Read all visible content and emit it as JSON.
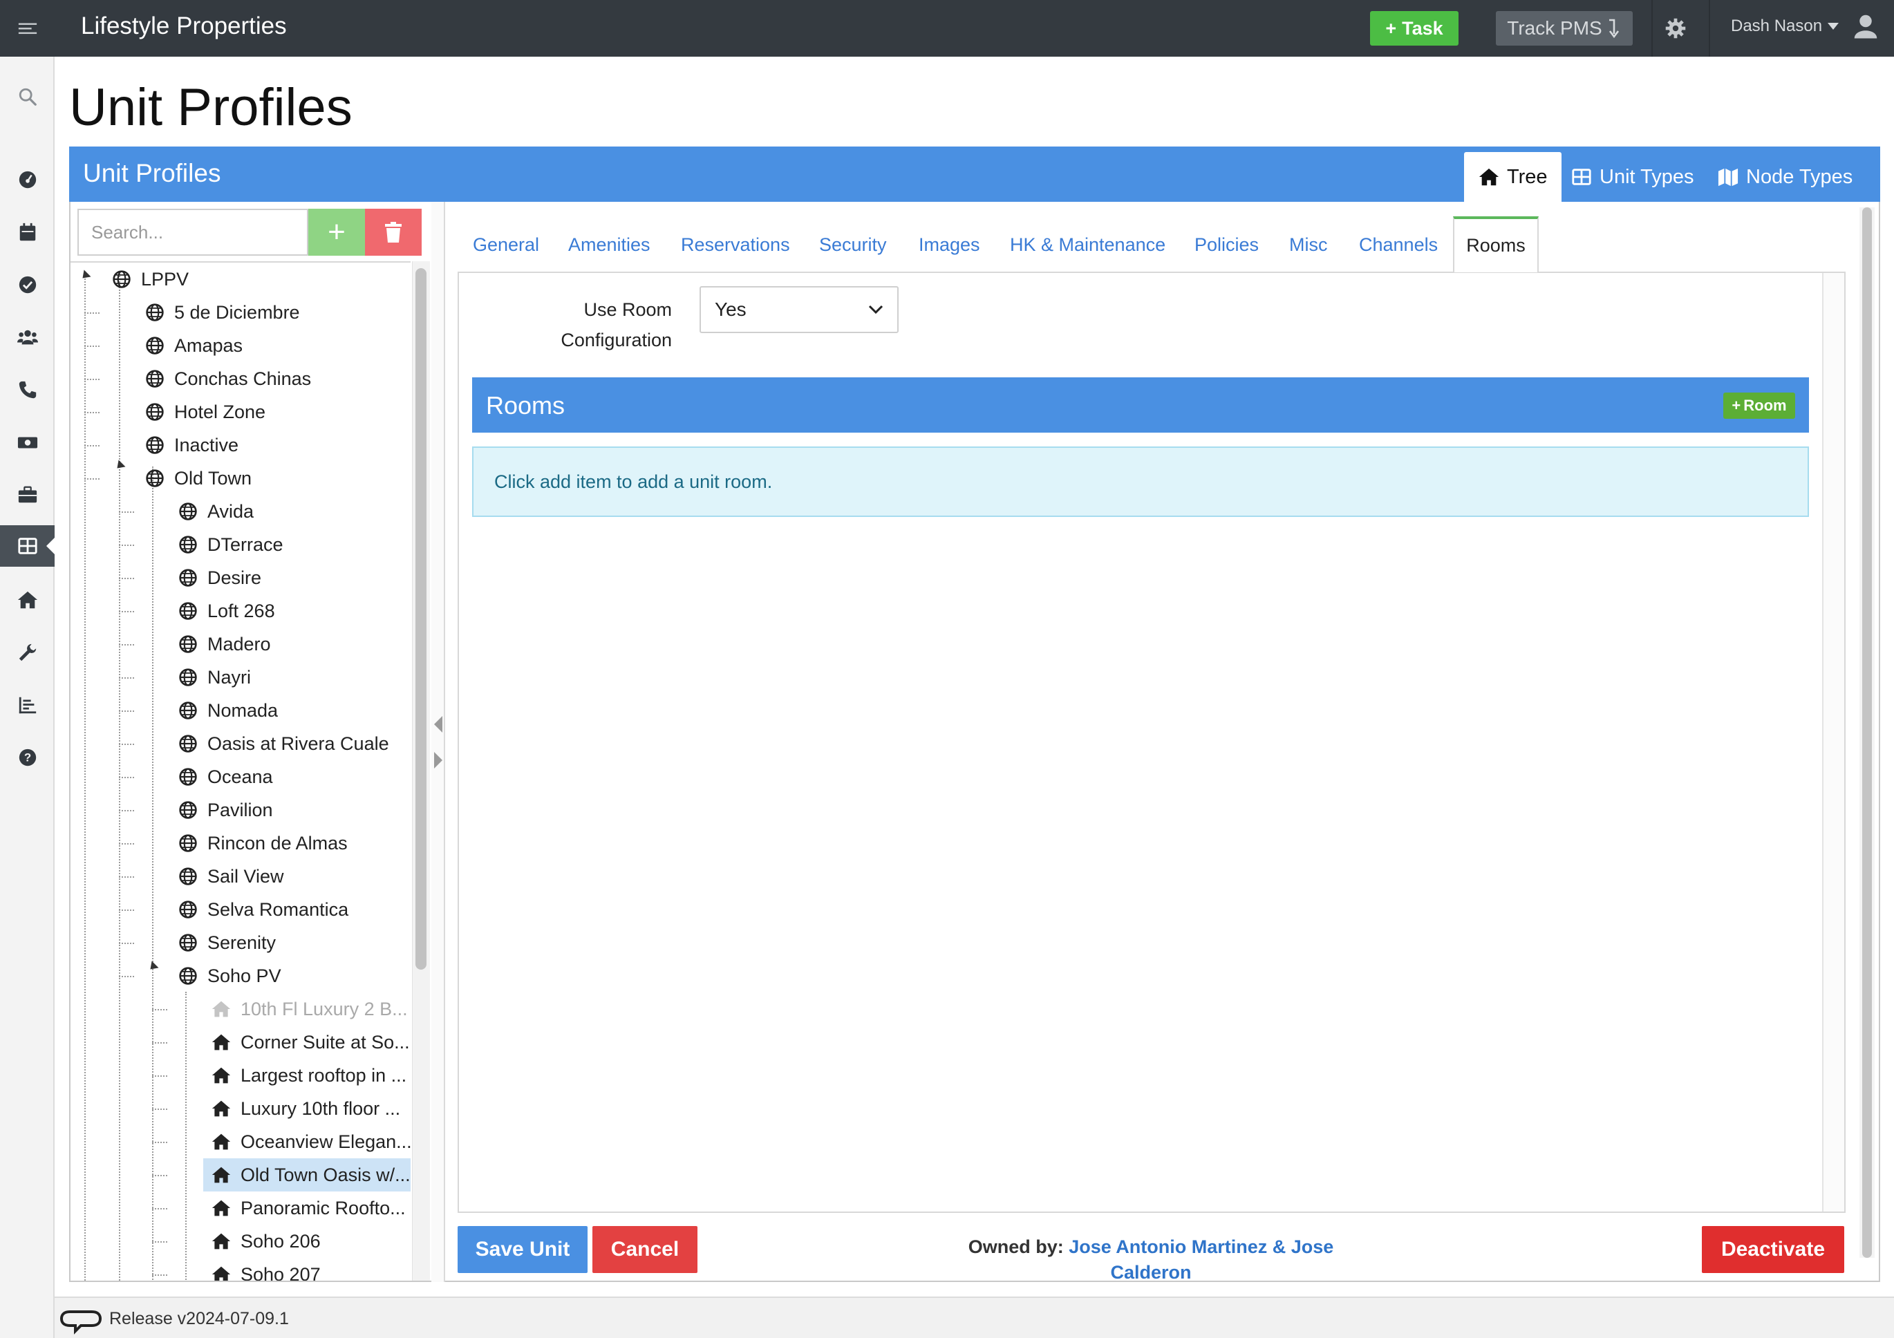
{
  "app": {
    "brand": "Lifestyle Properties",
    "task_button": "Task",
    "track_button": "Track PMS",
    "user_name": "Dash Nason"
  },
  "page": {
    "title": "Unit Profiles"
  },
  "panel": {
    "title": "Unit Profiles",
    "tabs": [
      {
        "label": "Tree",
        "icon": "home-icon",
        "active": true
      },
      {
        "label": "Unit Types",
        "icon": "grid-icon",
        "active": false
      },
      {
        "label": "Node Types",
        "icon": "map-icon",
        "active": false
      }
    ]
  },
  "tree": {
    "search_placeholder": "Search...",
    "nodes": [
      {
        "label": "LPPV",
        "icon": "globe-icon",
        "level": 0
      },
      {
        "label": "5 de Diciembre",
        "icon": "globe-icon",
        "level": 1
      },
      {
        "label": "Amapas",
        "icon": "globe-icon",
        "level": 1
      },
      {
        "label": "Conchas Chinas",
        "icon": "globe-icon",
        "level": 1
      },
      {
        "label": "Hotel Zone",
        "icon": "globe-icon",
        "level": 1
      },
      {
        "label": "Inactive",
        "icon": "globe-icon",
        "level": 1
      },
      {
        "label": "Old Town",
        "icon": "globe-icon",
        "level": 1
      },
      {
        "label": "Avida",
        "icon": "globe-icon",
        "level": 2
      },
      {
        "label": "DTerrace",
        "icon": "globe-icon",
        "level": 2
      },
      {
        "label": "Desire",
        "icon": "globe-icon",
        "level": 2
      },
      {
        "label": "Loft 268",
        "icon": "globe-icon",
        "level": 2
      },
      {
        "label": "Madero",
        "icon": "globe-icon",
        "level": 2
      },
      {
        "label": "Nayri",
        "icon": "globe-icon",
        "level": 2
      },
      {
        "label": "Nomada",
        "icon": "globe-icon",
        "level": 2
      },
      {
        "label": "Oasis at Rivera Cuale",
        "icon": "globe-icon",
        "level": 2
      },
      {
        "label": "Oceana",
        "icon": "globe-icon",
        "level": 2
      },
      {
        "label": "Pavilion",
        "icon": "globe-icon",
        "level": 2
      },
      {
        "label": "Rincon de Almas",
        "icon": "globe-icon",
        "level": 2
      },
      {
        "label": "Sail View",
        "icon": "globe-icon",
        "level": 2
      },
      {
        "label": "Selva Romantica",
        "icon": "globe-icon",
        "level": 2
      },
      {
        "label": "Serenity",
        "icon": "globe-icon",
        "level": 2
      },
      {
        "label": "Soho PV",
        "icon": "globe-icon",
        "level": 2
      },
      {
        "label": "10th Fl Luxury 2 B...",
        "icon": "home-icon",
        "level": 3,
        "state": "inactive"
      },
      {
        "label": "Corner Suite at So...",
        "icon": "home-icon",
        "level": 3
      },
      {
        "label": "Largest rooftop in ...",
        "icon": "home-icon",
        "level": 3
      },
      {
        "label": "Luxury 10th floor ...",
        "icon": "home-icon",
        "level": 3
      },
      {
        "label": "Oceanview Elegan...",
        "icon": "home-icon",
        "level": 3
      },
      {
        "label": "Old Town Oasis w/...",
        "icon": "home-icon",
        "level": 3,
        "state": "selected"
      },
      {
        "label": "Panoramic Roofto...",
        "icon": "home-icon",
        "level": 3
      },
      {
        "label": "Soho 206",
        "icon": "home-icon",
        "level": 3
      },
      {
        "label": "Soho 207",
        "icon": "home-icon",
        "level": 3
      }
    ]
  },
  "content_tabs": [
    {
      "label": "General"
    },
    {
      "label": "Amenities"
    },
    {
      "label": "Reservations"
    },
    {
      "label": "Security"
    },
    {
      "label": "Images"
    },
    {
      "label": "HK & Maintenance"
    },
    {
      "label": "Policies"
    },
    {
      "label": "Misc"
    },
    {
      "label": "Channels"
    },
    {
      "label": "Rooms"
    }
  ],
  "rooms_tab": {
    "config_label": "Use Room Configuration",
    "config_value": "Yes",
    "section_title": "Rooms",
    "add_button": "Room",
    "empty_message": "Click add item to add a unit room."
  },
  "actions": {
    "save": "Save Unit",
    "cancel": "Cancel",
    "owner_label": "Owned by:",
    "owner_name": "Jose Antonio Martinez & Jose Calderon",
    "deactivate": "Deactivate"
  },
  "status": {
    "release": "Release v2024-07-09.1"
  },
  "colors": {
    "header_bg": "#343a40",
    "panel_blue": "#4a90e2",
    "success_green": "#4cbd44",
    "danger_red": "#e02e2e",
    "info_bg": "#dff4fa"
  }
}
